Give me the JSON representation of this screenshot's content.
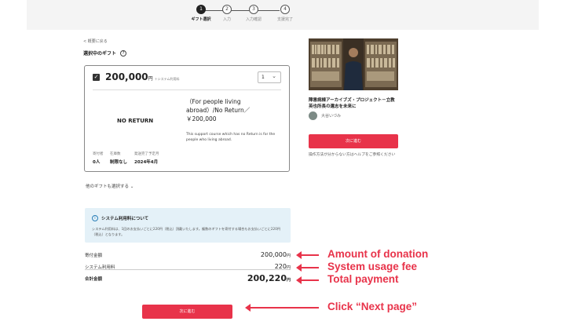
{
  "steps": [
    {
      "num": "1",
      "label": "ギフト選択"
    },
    {
      "num": "2",
      "label": "入力"
    },
    {
      "num": "3",
      "label": "入力確認"
    },
    {
      "num": "4",
      "label": "支援完了"
    }
  ],
  "back_link": "< 概要に戻る",
  "selected_gift_heading": "選択中のギフト",
  "gift": {
    "price": "200,000",
    "yen": "円",
    "price_note": "＋システム利用料",
    "quantity": "1",
    "image_text": "NO RETURN",
    "name_line1": "（For people living",
    "name_line2": "abroad）/No Return／",
    "name_line3": "￥200,000",
    "description": "This support course which has no Return is for the people who living abroad.",
    "meta_labels": [
      "寄付者",
      "在庫数",
      "発送完了予定月"
    ],
    "meta_values": [
      "0人",
      "制限なし",
      "2024年4月"
    ]
  },
  "other_gifts_link": "他のギフトも選択する",
  "system_fee_info": {
    "title": "システム利用料について",
    "text": "システム利用料は、1回のお支払いごとに220円（税込）頂戴いたします。複数のギフトを寄付する場合もお支払いごとに220円（税込）となります。"
  },
  "summary": {
    "donation_label": "寄付金額",
    "donation_value": "200,000",
    "fee_label": "システム利用料",
    "fee_value": "220",
    "total_label": "合計金額",
    "total_value": "200,220",
    "unit": "円"
  },
  "next_button": "次に進む",
  "side": {
    "project_title": "障害病棟アーカイブズ・プロジェクト－立教英也所長の遺志を未来に",
    "author": "大谷いづみ",
    "next_button": "次に進む",
    "help_text": "操作方法が分からない方はヘルプをご参照ください"
  },
  "annotations": {
    "amount": "Amount of donation",
    "fee": "System usage fee",
    "total": "Total payment",
    "next": "Click “Next page”"
  },
  "colors": {
    "accent": "#e8334a",
    "info_bg": "#e4f1f8"
  }
}
